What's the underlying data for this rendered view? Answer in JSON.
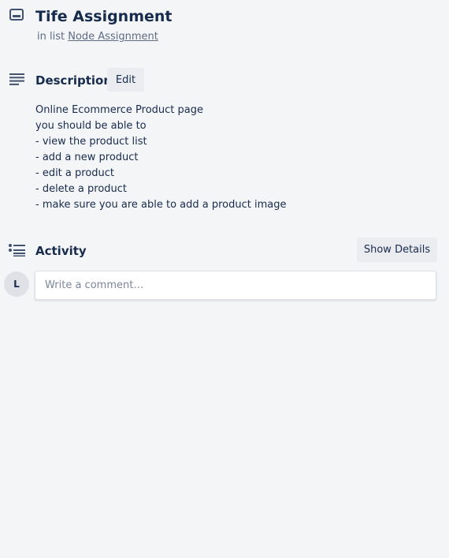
{
  "card": {
    "title": "Tife Assignment",
    "in_list_prefix": "in list",
    "list_name": "Node Assignment"
  },
  "description": {
    "heading": "Description",
    "edit_label": "Edit",
    "lines": [
      "Online Ecommerce Product page",
      "you should be able to",
      "- view the product list",
      "- add a new product",
      "- edit a product",
      "- delete a product",
      "- make sure you are able to add a product image"
    ]
  },
  "activity": {
    "heading": "Activity",
    "show_details_label": "Show Details",
    "comment_placeholder": "Write a comment…"
  },
  "user": {
    "avatar_initial": "L"
  },
  "icons": {
    "card": "card-icon",
    "description": "description-icon",
    "activity": "activity-icon"
  },
  "colors": {
    "background": "#f4f5f7",
    "text": "#172b4d",
    "muted": "#5e6c84",
    "button_bg": "#ebecf0",
    "icon": "#42526e"
  }
}
